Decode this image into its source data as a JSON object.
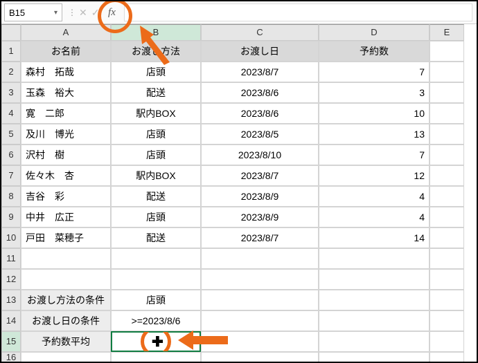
{
  "formula_bar": {
    "cell_ref": "B15",
    "fx_label": "fx"
  },
  "columns": [
    "A",
    "B",
    "C",
    "D",
    "E"
  ],
  "row_numbers": [
    1,
    2,
    3,
    4,
    5,
    6,
    7,
    8,
    9,
    10,
    11,
    12,
    13,
    14,
    15,
    16
  ],
  "headers": {
    "A": "お名前",
    "B": "お渡し方法",
    "C": "お渡し日",
    "D": "予約数"
  },
  "rows": [
    {
      "name": "森村　拓哉",
      "method": "店頭",
      "date": "2023/8/7",
      "count": "7"
    },
    {
      "name": "玉森　裕大",
      "method": "配送",
      "date": "2023/8/6",
      "count": "3"
    },
    {
      "name": "寛　二郎",
      "method": "駅内BOX",
      "date": "2023/8/6",
      "count": "10"
    },
    {
      "name": "及川　博光",
      "method": "店頭",
      "date": "2023/8/5",
      "count": "13"
    },
    {
      "name": "沢村　樹",
      "method": "店頭",
      "date": "2023/8/10",
      "count": "7"
    },
    {
      "name": "佐々木　杏",
      "method": "駅内BOX",
      "date": "2023/8/7",
      "count": "12"
    },
    {
      "name": "吉谷　彩",
      "method": "配送",
      "date": "2023/8/9",
      "count": "4"
    },
    {
      "name": "中井　広正",
      "method": "店頭",
      "date": "2023/8/9",
      "count": "4"
    },
    {
      "name": "戸田　菜穂子",
      "method": "配送",
      "date": "2023/8/7",
      "count": "14"
    }
  ],
  "conditions": {
    "method_label": "お渡し方法の条件",
    "method_value": "店頭",
    "date_label": "お渡し日の条件",
    "date_value": ">=2023/8/6",
    "avg_label": "予約数平均"
  },
  "selected_cell": "B15",
  "colors": {
    "accent": "#ec6b1a",
    "select": "#107c41"
  }
}
